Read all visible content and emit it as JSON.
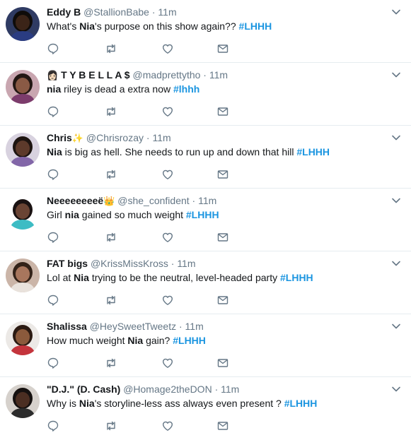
{
  "colors": {
    "accent": "#1b95e0",
    "muted": "#657786",
    "text": "#14171a",
    "divider": "#e6ecf0"
  },
  "tweets": [
    {
      "name": "Eddy B",
      "name_emoji": "",
      "name_prefix": "",
      "handle": "@StallionBabe",
      "time": "11m",
      "text": [
        {
          "t": "What's ",
          "k": "plain"
        },
        {
          "t": "Nia",
          "k": "hl"
        },
        {
          "t": "'s purpose on this show again?? ",
          "k": "plain"
        },
        {
          "t": "#LHHH",
          "k": "tag"
        }
      ],
      "avatar": {
        "bg": "#2f3b63",
        "skin": "#3b2418",
        "hair": "#0f0c0a",
        "shirt": "#2a3c82"
      }
    },
    {
      "name": "T Y B E L L A $",
      "name_emoji": "",
      "name_prefix": "👩🏻",
      "handle": "@madprettytho",
      "time": "11m",
      "text": [
        {
          "t": "nia",
          "k": "hl"
        },
        {
          "t": " riley is dead a extra now ",
          "k": "plain"
        },
        {
          "t": "#lhhh",
          "k": "tag"
        }
      ],
      "avatar": {
        "bg": "#c9a6b0",
        "skin": "#8a5a45",
        "hair": "#231713",
        "shirt": "#7c3c6c"
      }
    },
    {
      "name": "Chris",
      "name_emoji": "✨",
      "name_prefix": "",
      "handle": "@Chrisrozay",
      "time": "11m",
      "text": [
        {
          "t": "Nia",
          "k": "hl"
        },
        {
          "t": " is big as hell. She needs to run up and down that hill ",
          "k": "plain"
        },
        {
          "t": "#LHHH",
          "k": "tag"
        }
      ],
      "avatar": {
        "bg": "#d8d2df",
        "skin": "#5d3a2b",
        "hair": "#1d1410",
        "shirt": "#8266a8"
      }
    },
    {
      "name": "Neeeeeeeeë",
      "name_emoji": "👑",
      "name_prefix": "",
      "handle": "@she_confident",
      "time": "11m",
      "text": [
        {
          "t": "Girl ",
          "k": "plain"
        },
        {
          "t": "nia",
          "k": "hl"
        },
        {
          "t": " gained so much weight ",
          "k": "plain"
        },
        {
          "t": "#LHHH",
          "k": "tag"
        }
      ],
      "avatar": {
        "bg": "#ffffff",
        "skin": "#6a4434",
        "hair": "#1a1212",
        "shirt": "#3dbcc4"
      }
    },
    {
      "name": "FAT bigs",
      "name_emoji": "",
      "name_prefix": "",
      "handle": "@KrissMissKross",
      "time": "11m",
      "text": [
        {
          "t": "Lol at ",
          "k": "plain"
        },
        {
          "t": "Nia",
          "k": "hl"
        },
        {
          "t": " trying to be the neutral, level-headed party ",
          "k": "plain"
        },
        {
          "t": "#LHHH",
          "k": "tag"
        }
      ],
      "avatar": {
        "bg": "#cbb5a8",
        "skin": "#a8765d",
        "hair": "#332218",
        "shirt": "#e9e2dc"
      }
    },
    {
      "name": "Shalissa",
      "name_emoji": "",
      "name_prefix": "",
      "handle": "@HeySweetTweetz",
      "time": "11m",
      "text": [
        {
          "t": "How much weight ",
          "k": "plain"
        },
        {
          "t": "Nia",
          "k": "hl"
        },
        {
          "t": " gain? ",
          "k": "plain"
        },
        {
          "t": "#LHHH",
          "k": "tag"
        }
      ],
      "avatar": {
        "bg": "#ece9e6",
        "skin": "#8b5a3c",
        "hair": "#2b1a12",
        "shirt": "#c4343c"
      }
    },
    {
      "name": "\"D.J.\" (D. Cash)",
      "name_emoji": "",
      "name_prefix": "",
      "handle": "@Homage2theDON",
      "time": "11m",
      "text": [
        {
          "t": "Why is ",
          "k": "plain"
        },
        {
          "t": "Nia",
          "k": "hl"
        },
        {
          "t": "'s storyline-less ass always even present ? ",
          "k": "plain"
        },
        {
          "t": "#LHHH",
          "k": "tag"
        }
      ],
      "avatar": {
        "bg": "#d6d1cc",
        "skin": "#4b2e22",
        "hair": "#161110",
        "shirt": "#2c2c2c"
      }
    }
  ],
  "icons": {
    "reply": "reply-icon",
    "retweet": "retweet-icon",
    "like": "heart-icon",
    "dm": "envelope-icon",
    "menu": "chevron-down-icon"
  }
}
